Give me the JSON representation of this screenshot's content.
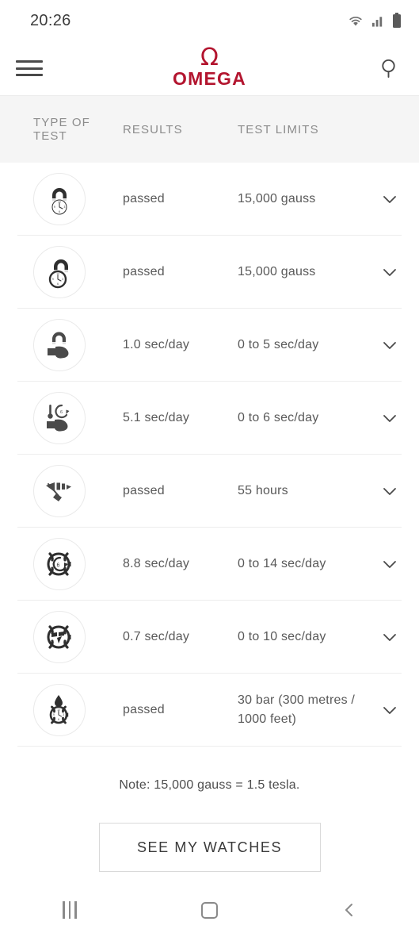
{
  "status_bar": {
    "time": "20:26",
    "icons": [
      "wifi-icon",
      "cellular-signal-icon",
      "battery-icon"
    ]
  },
  "app_bar": {
    "menu_icon": "hamburger-menu-icon",
    "brand_glyph": "Ω",
    "brand_name": "OMEGA",
    "brand_color": "#b3152f",
    "search_icon": "search-icon"
  },
  "table": {
    "headers": {
      "type_of_test": "TYPE OF TEST",
      "results": "RESULTS",
      "test_limits": "TEST LIMITS"
    },
    "rows": [
      {
        "icon": "magnet-over-movement-icon",
        "result": "passed",
        "limit": "15,000 gauss",
        "expand_icon": "chevron-down-icon"
      },
      {
        "icon": "magnet-over-watch-icon",
        "result": "passed",
        "limit": "15,000 gauss",
        "expand_icon": "chevron-down-icon"
      },
      {
        "icon": "magnet-watch-on-wrist-icon",
        "result": "1.0 sec/day",
        "limit": "0 to 5 sec/day",
        "expand_icon": "chevron-down-icon"
      },
      {
        "icon": "thermometer-rotation-wrist-icon",
        "result": "5.1 sec/day",
        "limit": "0 to 6 sec/day",
        "expand_icon": "chevron-down-icon"
      },
      {
        "icon": "power-reserve-gauge-icon",
        "result": "passed",
        "limit": "55 hours",
        "expand_icon": "chevron-down-icon"
      },
      {
        "icon": "watch-six-positions-icon",
        "result": "8.8 sec/day",
        "limit": "0 to 14 sec/day",
        "expand_icon": "chevron-down-icon"
      },
      {
        "icon": "watch-deviation-icon",
        "result": "0.7 sec/day",
        "limit": "0 to 10 sec/day",
        "expand_icon": "chevron-down-icon"
      },
      {
        "icon": "water-resistance-watch-icon",
        "result": "passed",
        "limit": "30 bar (300 metres / 1000 feet)",
        "expand_icon": "chevron-down-icon"
      }
    ]
  },
  "footer": {
    "note": "Note: 15,000 gauss = 1.5 tesla.",
    "cta_label": "SEE MY WATCHES"
  },
  "nav_bar": {
    "recent_icon": "recent-apps-icon",
    "home_icon": "home-icon",
    "back_icon": "back-icon"
  }
}
